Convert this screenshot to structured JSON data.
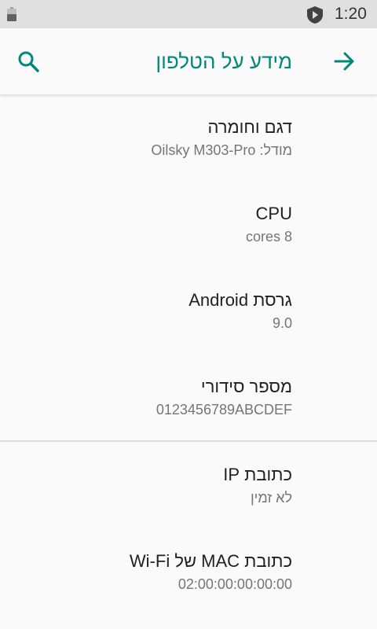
{
  "status_bar": {
    "time": "1:20",
    "icons": [
      "battery-icon",
      "shield-icon"
    ]
  },
  "app_bar": {
    "title": "מידע על הטלפון",
    "icons": [
      "search-icon",
      "arrow-forward-icon"
    ]
  },
  "colors": {
    "accent": "#00897b",
    "status_bar_bg": "#e0e0e0",
    "background": "#fafafa",
    "title_text": "#212121",
    "summary_text": "#757575"
  },
  "preferences": [
    {
      "title": "דגם וחומרה",
      "summary": "מודל: Oilsky M303-Pro"
    },
    {
      "title": "CPU",
      "summary": "8 cores"
    },
    {
      "title": "גרסת Android",
      "summary": "9.0"
    },
    {
      "title": "מספר סידורי",
      "summary": "0123456789ABCDEF"
    },
    {
      "title": "כתובת IP",
      "summary": "לא זמין"
    },
    {
      "title": "כתובת MAC של Wi-Fi",
      "summary": "02:00:00:00:00:00"
    }
  ]
}
